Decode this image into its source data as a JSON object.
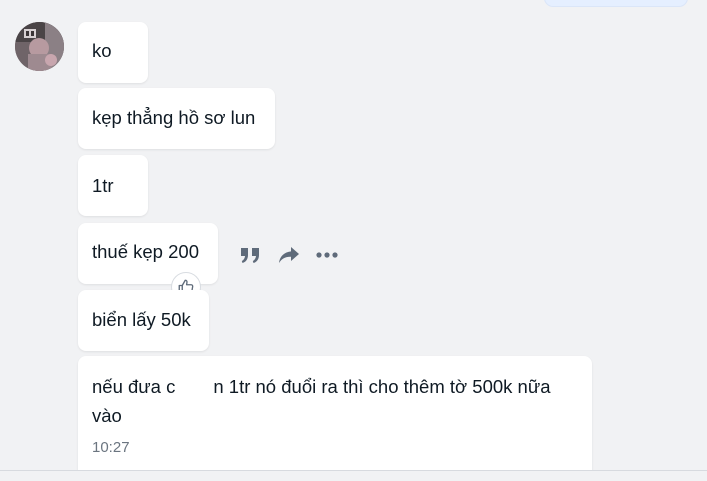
{
  "conversation": {
    "messages": [
      {
        "text": "ko"
      },
      {
        "text": "kẹp thẳng hồ sơ lun"
      },
      {
        "text": "1tr"
      },
      {
        "text": "thuế kẹp 200"
      },
      {
        "text": "biển lấy 50k"
      },
      {
        "text_part1": "nếu đưa c",
        "text_part2": "n 1tr nó đuổi ra thì cho thêm tờ 500k nữa vào",
        "time": "10:27"
      }
    ]
  },
  "icons": {
    "reaction": "thumbs-up-icon",
    "quote": "quote-icon",
    "forward": "forward-icon",
    "more": "more-icon"
  },
  "colors": {
    "background": "#f1f2f4",
    "bubble": "#ffffff",
    "sent_bubble": "#e5efff",
    "icon": "#5f6b7a"
  }
}
